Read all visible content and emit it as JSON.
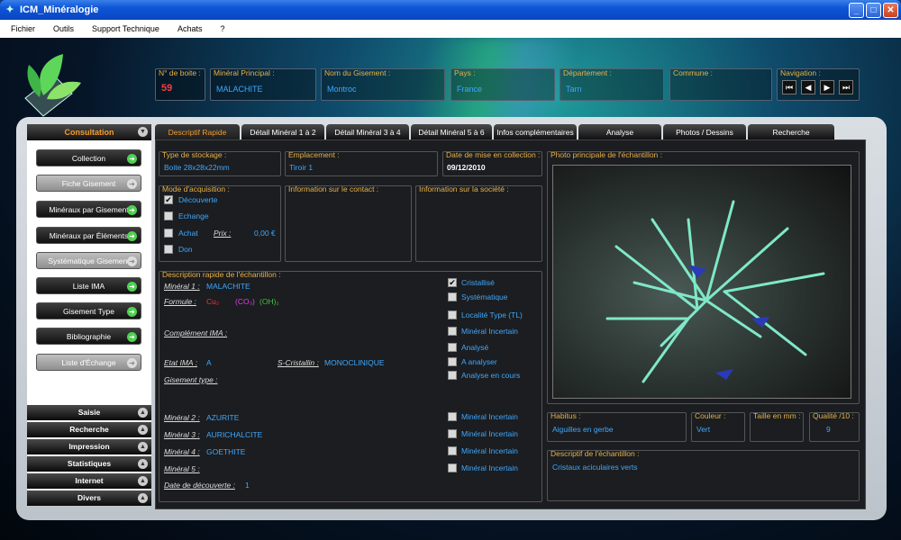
{
  "window": {
    "title": "ICM_Minéralogie"
  },
  "menu": [
    "Fichier",
    "Outils",
    "Support Technique",
    "Achats",
    "?"
  ],
  "header": {
    "boite": {
      "label": "N° de boite :",
      "value": "59"
    },
    "mineral": {
      "label": "Minéral Principal :",
      "value": "MALACHITE"
    },
    "gisement": {
      "label": "Nom du Gisement :",
      "value": "Montroc"
    },
    "pays": {
      "label": "Pays :",
      "value": "France"
    },
    "departement": {
      "label": "Département :",
      "value": "Tarn"
    },
    "commune": {
      "label": "Commune :",
      "value": ""
    },
    "navigation": {
      "label": "Navigation :"
    }
  },
  "sidebar": {
    "consultation": "Consultation",
    "buttons": [
      "Collection",
      "Fiche Gisement",
      "Minéraux par Gisement",
      "Minéraux par Éléments",
      "Systématique Gisement",
      "Liste IMA",
      "Gisement Type",
      "Bibliographie",
      "Liste d'Échange"
    ],
    "categories": [
      "Saisie",
      "Recherche",
      "Impression",
      "Statistiques",
      "Internet",
      "Divers"
    ]
  },
  "tabs": [
    "Descriptif Rapide",
    "Détail Minéral 1 à 2",
    "Détail Minéral 3 à 4",
    "Détail Minéral 5 à 6",
    "Infos complémentaires",
    "Analyse",
    "Photos / Dessins",
    "Recherche"
  ],
  "stockage": {
    "label": "Type de stockage :",
    "value": "Boite 28x28x22mm"
  },
  "emplacement": {
    "label": "Emplacement :",
    "value": "Tiroir 1"
  },
  "date_collection": {
    "label": "Date de mise en collection :",
    "value": "09/12/2010"
  },
  "acquisition": {
    "label": "Mode d'acquisition :",
    "options": [
      "Découverte",
      "Echange",
      "Achat",
      "Don"
    ],
    "prix_label": "Prix :",
    "prix_value": "0,00 €"
  },
  "contact": {
    "label": "Information sur le contact :"
  },
  "societe": {
    "label": "Information sur la société :"
  },
  "description": {
    "label": "Description rapide de l'échantillon :",
    "m1_label": "Minéral 1 :",
    "m1": "MALACHITE",
    "formule_label": "Formule :",
    "formule_parts": [
      "Cu₂",
      "(CO₃)",
      "(OH)₂"
    ],
    "ima_label": "Complément IMA :",
    "etat_label": "Etat IMA :",
    "etat": "A",
    "scristallin_label": "S-Cristallin :",
    "scristallin": "MONOCLINIQUE",
    "gisement_type_label": "Gisement type :",
    "m2_label": "Minéral 2 :",
    "m2": "AZURITE",
    "m3_label": "Minéral 3 :",
    "m3": "AURICHALCITE",
    "m4_label": "Minéral 4 :",
    "m4": "GOETHITE",
    "m5_label": "Minéral 5 :",
    "date_label": "Date de découverte :",
    "date": "1",
    "checks": [
      "Cristallisé",
      "Systématique",
      "Localité Type (TL)",
      "Minéral Incertain",
      "Analysé",
      "A analyser",
      "Analyse en cours"
    ],
    "incertain": "Minéral Incertain"
  },
  "photo": {
    "label": "Photo principale de l'échantillon :"
  },
  "habitus": {
    "label": "Habitus :",
    "value": "Aiguilles en gerbe"
  },
  "couleur": {
    "label": "Couleur :",
    "value": "Vert"
  },
  "taille": {
    "label": "Taille en mm :",
    "value": ""
  },
  "qualite": {
    "label": "Qualité /10 :",
    "value": "9"
  },
  "descriptif": {
    "label": "Descriptif de l'échantillon :",
    "value": "Cristaux aciculaires verts"
  }
}
